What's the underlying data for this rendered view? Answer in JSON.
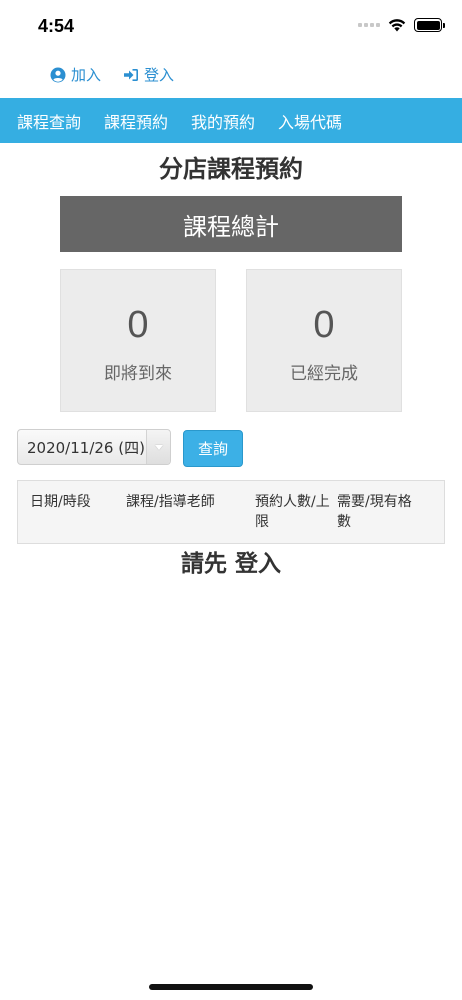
{
  "status_bar": {
    "time": "4:54"
  },
  "auth": {
    "join_label": "加入",
    "login_label": "登入"
  },
  "nav": {
    "items": [
      {
        "label": "課程查詢"
      },
      {
        "label": "課程預約"
      },
      {
        "label": "我的預約"
      },
      {
        "label": "入場代碼"
      }
    ]
  },
  "page": {
    "title": "分店課程預約"
  },
  "summary": {
    "header": "課程總計",
    "upcoming": {
      "value": "0",
      "label": "即將到來"
    },
    "completed": {
      "value": "0",
      "label": "已經完成"
    }
  },
  "query": {
    "date_value": "2020/11/26 (四)",
    "button_label": "查詢"
  },
  "table": {
    "headers": [
      "日期/時段",
      "課程/指導老師",
      "預約人數/上限",
      "需要/現有格數"
    ]
  },
  "login_prompt": "請先 登入",
  "colors": {
    "accent": "#35aee2",
    "link": "#2b8fd1",
    "summary_header": "#666666"
  }
}
